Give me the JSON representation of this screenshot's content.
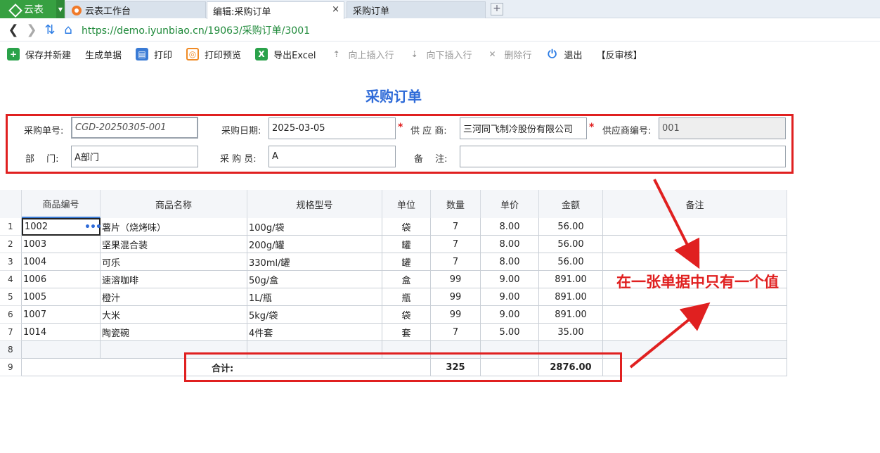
{
  "tabs": {
    "app_label": "云表",
    "items": [
      {
        "label": "云表工作台"
      },
      {
        "label": "编辑:采购订单",
        "close": "×"
      },
      {
        "label": "采购订单"
      }
    ],
    "new_tab": "+"
  },
  "address": {
    "url": "https://demo.iyunbiao.cn/19063/采购订单/3001"
  },
  "toolbar": {
    "save_new": "保存并新建",
    "generate": "生成单据",
    "print": "打印",
    "print_preview": "打印预览",
    "export_excel": "导出Excel",
    "insert_above": "向上插入行",
    "insert_below": "向下插入行",
    "delete_row": "删除行",
    "exit": "退出",
    "unaudit": "【反审核】"
  },
  "page_title": "采购订单",
  "form": {
    "order_no_label": "采购单号:",
    "order_no": "CGD-20250305-001",
    "date_label": "采购日期:",
    "date": "2025-03-05",
    "supplier_label": "供 应 商:",
    "supplier": "三河同飞制冷股份有限公司",
    "supplier_code_label": "供应商编号:",
    "supplier_code": "001",
    "dept_label": "部　 门:",
    "dept": "A部门",
    "buyer_label": "采 购 员:",
    "buyer": "A",
    "remark_label": "备　 注:",
    "remark": "",
    "required_mark": "*"
  },
  "grid": {
    "headers": [
      "商品编号",
      "商品名称",
      "规格型号",
      "单位",
      "数量",
      "单价",
      "金额",
      "备注"
    ],
    "rows": [
      {
        "num": "1",
        "code": "1002",
        "name": "薯片（烧烤味）",
        "spec": "100g/袋",
        "unit": "袋",
        "qty": "7",
        "price": "8.00",
        "amount": "56.00",
        "remark": ""
      },
      {
        "num": "2",
        "code": "1003",
        "name": "坚果混合装",
        "spec": "200g/罐",
        "unit": "罐",
        "qty": "7",
        "price": "8.00",
        "amount": "56.00",
        "remark": ""
      },
      {
        "num": "3",
        "code": "1004",
        "name": "可乐",
        "spec": "330ml/罐",
        "unit": "罐",
        "qty": "7",
        "price": "8.00",
        "amount": "56.00",
        "remark": ""
      },
      {
        "num": "4",
        "code": "1006",
        "name": "速溶咖啡",
        "spec": "50g/盒",
        "unit": "盒",
        "qty": "99",
        "price": "9.00",
        "amount": "891.00",
        "remark": ""
      },
      {
        "num": "5",
        "code": "1005",
        "name": "橙汁",
        "spec": "1L/瓶",
        "unit": "瓶",
        "qty": "99",
        "price": "9.00",
        "amount": "891.00",
        "remark": ""
      },
      {
        "num": "6",
        "code": "1007",
        "name": "大米",
        "spec": "5kg/袋",
        "unit": "袋",
        "qty": "99",
        "price": "9.00",
        "amount": "891.00",
        "remark": ""
      },
      {
        "num": "7",
        "code": "1014",
        "name": "陶瓷碗",
        "spec": "4件套",
        "unit": "套",
        "qty": "7",
        "price": "5.00",
        "amount": "35.00",
        "remark": ""
      }
    ],
    "empty_row_num": "8",
    "total_row_num": "9",
    "total_label": "合计:",
    "total_qty": "325",
    "total_amount": "2876.00",
    "cell_menu": "•••"
  },
  "annotation": "在一张单据中只有一个值",
  "colors": {
    "accent": "#2f6bd8",
    "highlight": "#e02020",
    "app_green": "#37a041"
  }
}
